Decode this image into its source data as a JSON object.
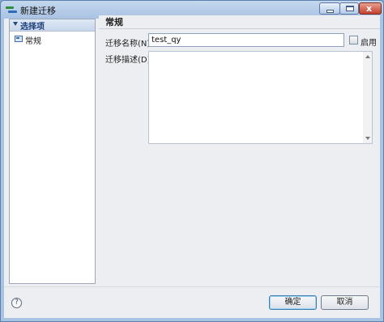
{
  "window": {
    "title": "新建迁移",
    "close_glyph": "x"
  },
  "sidebar": {
    "header_label": "选择项",
    "items": [
      {
        "label": "常规"
      }
    ]
  },
  "form": {
    "page_title": "常规",
    "name_label": "迁移名称(N):",
    "name_value": "test_qy",
    "enable_label": "启用",
    "enable_checked": false,
    "desc_label": "迁移描述(D):",
    "desc_value": ""
  },
  "footer": {
    "help_glyph": "?",
    "ok_label": "确定",
    "cancel_label": "取消"
  },
  "colors": {
    "window_frame": "#a9c3e3",
    "client_bg": "#eceef1",
    "header_text": "#1b3f7a"
  },
  "icons": [
    "app-icon",
    "minimize-icon",
    "maximize-icon",
    "close-icon",
    "collapse-triangle-icon",
    "page-icon",
    "help-icon"
  ]
}
